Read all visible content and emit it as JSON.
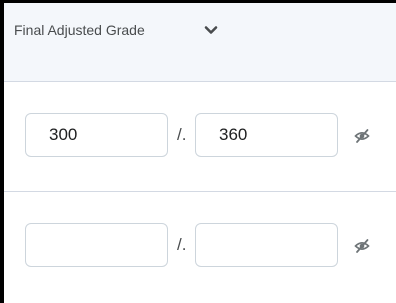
{
  "header": {
    "title": "Final Adjusted Grade",
    "chevron_icon": "chevron-down-icon"
  },
  "rows": [
    {
      "score_value": "300",
      "separator": "/.",
      "out_of_value": "360",
      "visibility_icon": "eye-slash-icon"
    },
    {
      "score_value": "",
      "separator": "/.",
      "out_of_value": "",
      "visibility_icon": "eye-slash-icon"
    }
  ],
  "colors": {
    "header_bg": "#f4f7fb",
    "border": "#d3d9e3",
    "input_border": "#cdd5dc",
    "text": "#494c4e"
  }
}
